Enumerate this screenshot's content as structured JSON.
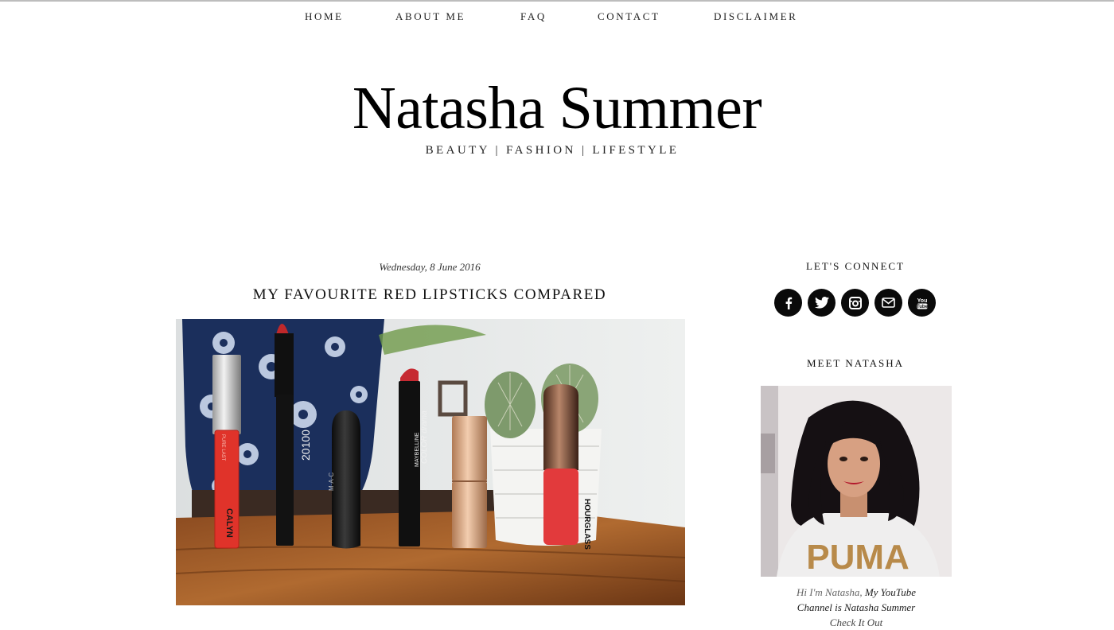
{
  "nav": {
    "items": [
      "HOME",
      "ABOUT ME",
      "FAQ",
      "CONTACT",
      "DISCLAIMER"
    ]
  },
  "header": {
    "title": "Natasha Summer",
    "tagline": "BEAUTY | FASHION | LIFESTYLE"
  },
  "post": {
    "date": "Wednesday, 8 June 2016",
    "title": "MY FAVOURITE RED LIPSTICKS COMPARED",
    "image_text": {
      "calyn": "CALYN",
      "calyn_side": "PURE LAST",
      "pencil": "20100",
      "mac": "M·A·C",
      "maybelline_brand": "MAYBELLINE",
      "maybelline_line": "COLOR drama",
      "hourglass": "HOURGLASS"
    }
  },
  "sidebar": {
    "connect_title": "LET'S CONNECT",
    "social_icons": [
      "facebook-icon",
      "twitter-icon",
      "instagram-icon",
      "email-icon",
      "youtube-icon"
    ],
    "meet_title": "MEET NATASHA",
    "portrait_shirt_text": "PUMA",
    "bio": {
      "intro": "Hi I'm Natasha,",
      "line1_rest": " My YouTube",
      "line2": "Channel is Natasha Summer",
      "line3": "Check It Out"
    }
  },
  "colors": {
    "text": "#111111",
    "social_bg": "#0a0a0a",
    "lipstick_red": "#e0332a"
  }
}
